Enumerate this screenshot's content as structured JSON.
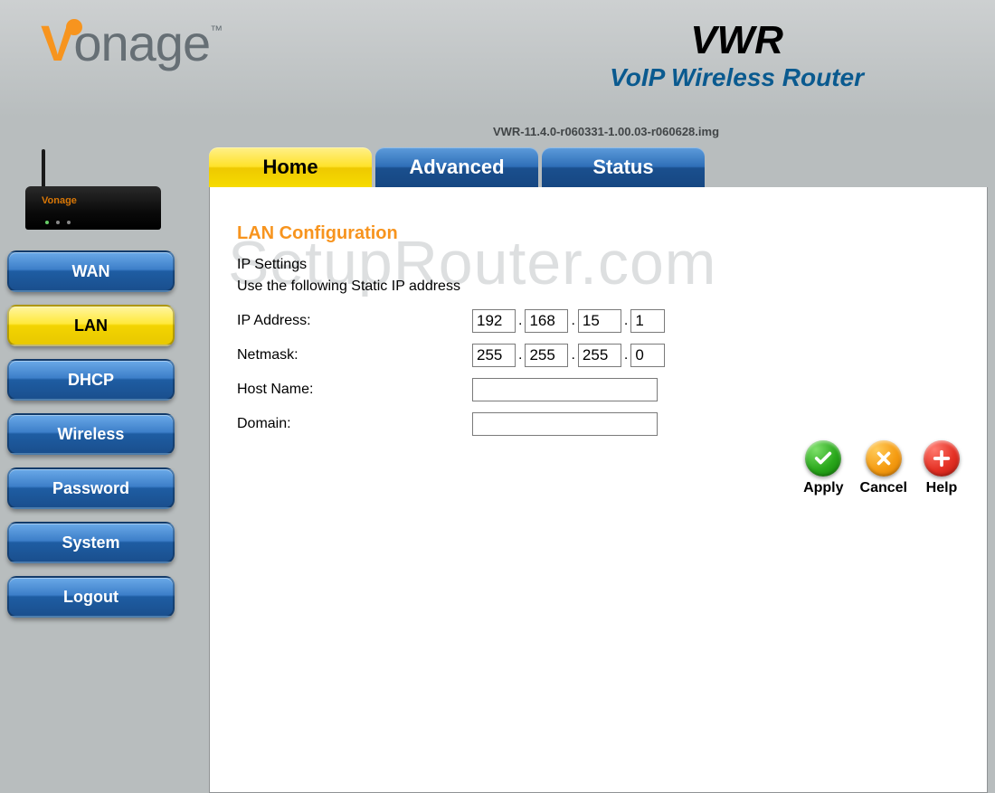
{
  "brand": {
    "v": "V",
    "rest": "onage",
    "tm": "™"
  },
  "product": {
    "name": "VWR",
    "subtitle": "VoIP Wireless Router"
  },
  "firmware": "VWR-11.4.0-r060331-1.00.03-r060628.img",
  "sidebar": {
    "items": [
      {
        "label": "WAN",
        "active": false
      },
      {
        "label": "LAN",
        "active": true
      },
      {
        "label": "DHCP",
        "active": false
      },
      {
        "label": "Wireless",
        "active": false
      },
      {
        "label": "Password",
        "active": false
      },
      {
        "label": "System",
        "active": false
      },
      {
        "label": "Logout",
        "active": false
      }
    ]
  },
  "tabs": [
    {
      "label": "Home",
      "active": true
    },
    {
      "label": "Advanced",
      "active": false
    },
    {
      "label": "Status",
      "active": false
    }
  ],
  "watermark_text": "SetupRouter.com",
  "section": {
    "title": "LAN Configuration",
    "subsection": "IP Settings",
    "instruction": "Use the following Static IP address",
    "fields": {
      "ip_label": "IP Address:",
      "ip": [
        "192",
        "168",
        "15",
        "1"
      ],
      "netmask_label": "Netmask:",
      "netmask": [
        "255",
        "255",
        "255",
        "0"
      ],
      "hostname_label": "Host Name:",
      "hostname": "",
      "domain_label": "Domain:",
      "domain": ""
    }
  },
  "actions": {
    "apply": "Apply",
    "cancel": "Cancel",
    "help": "Help"
  }
}
